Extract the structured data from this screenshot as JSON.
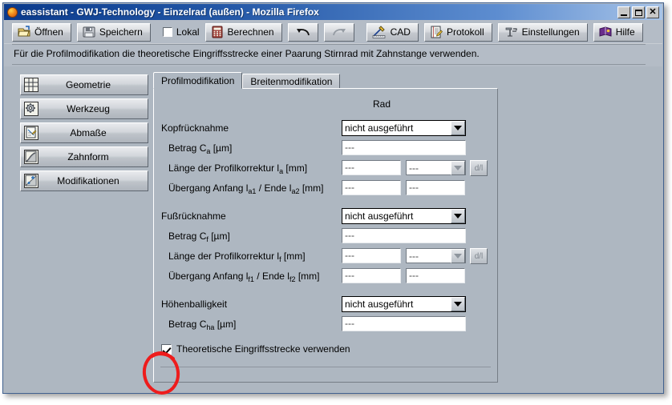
{
  "window": {
    "title": "eassistant - GWJ-Technology - Einzelrad (außen) - Mozilla Firefox",
    "app_icon": "firefox-icon",
    "minimize_label": "Minimieren",
    "maximize_label": "Maximieren",
    "close_label": "Schließen"
  },
  "toolbar": {
    "open_label": "Öffnen",
    "save_label": "Speichern",
    "lokal_label": "Lokal",
    "lokal_checked": false,
    "calc_label": "Berechnen",
    "undo_label": "",
    "redo_label": "",
    "cad_label": "CAD",
    "protocol_label": "Protokoll",
    "settings_label": "Einstellungen",
    "help_label": "Hilfe"
  },
  "hint": {
    "text": "Für die Profilmodifikation die theoretische Eingriffsstrecke einer Paarung Stirnrad mit Zahnstange verwenden."
  },
  "sidebar": {
    "items": [
      {
        "label": "Geometrie",
        "icon": "grid-icon"
      },
      {
        "label": "Werkzeug",
        "icon": "gear-icon"
      },
      {
        "label": "Abmaße",
        "icon": "ruler-icon"
      },
      {
        "label": "Zahnform",
        "icon": "curve-icon"
      },
      {
        "label": "Modifikationen",
        "icon": "modify-icon"
      }
    ]
  },
  "tabs": [
    {
      "label": "Profilmodifikation",
      "active": true
    },
    {
      "label": "Breitenmodifikation",
      "active": false
    }
  ],
  "panel": {
    "column_header": "Rad",
    "groups": [
      {
        "title": "Kopfrücknahme",
        "select_value": "nicht ausgeführt",
        "rows": [
          {
            "label_pre": "Betrag C",
            "label_sub": "a",
            "label_post": " [µm]",
            "value": "---"
          },
          {
            "label_pre": "Länge der Profilkorrektur l",
            "label_sub": "a",
            "label_post": " [mm]",
            "value": "---",
            "second_value": "---",
            "has_select": true,
            "has_dl_button": true,
            "dl_label": "d/l"
          },
          {
            "label_pre": "Übergang Anfang l",
            "label_sub": "a1",
            "label_mid": " / Ende l",
            "label_sub2": "a2",
            "label_post": " [mm]",
            "value": "---",
            "second_value": "---"
          }
        ]
      },
      {
        "title": "Fußrücknahme",
        "select_value": "nicht ausgeführt",
        "rows": [
          {
            "label_pre": "Betrag C",
            "label_sub": "f",
            "label_post": " [µm]",
            "value": "---"
          },
          {
            "label_pre": "Länge der Profilkorrektur l",
            "label_sub": "f",
            "label_post": " [mm]",
            "value": "---",
            "second_value": "---",
            "has_select": true,
            "has_dl_button": true,
            "dl_label": "d/l"
          },
          {
            "label_pre": "Übergang Anfang l",
            "label_sub": "f1",
            "label_mid": " / Ende l",
            "label_sub2": "f2",
            "label_post": " [mm]",
            "value": "---",
            "second_value": "---"
          }
        ]
      },
      {
        "title": "Höhenballigkeit",
        "select_value": "nicht ausgeführt",
        "rows": [
          {
            "label_pre": "Betrag C",
            "label_sub": "ha",
            "label_post": " [µm]",
            "value": "---"
          }
        ]
      }
    ],
    "bottom_checkbox": {
      "label": "Theoretische Eingriffsstrecke verwenden",
      "checked": true
    }
  },
  "annotation": {
    "shape": "red-ellipse",
    "color": "#ee1c1c",
    "target": "Theoretische Eingriffsstrecke verwenden checkbox"
  },
  "colors": {
    "window_background": "#aeb7c1",
    "titlebar_start": "#0a3a8c",
    "titlebar_end": "#a8c4e8",
    "field_background": "#ffffff",
    "annotation_red": "#ee1c1c"
  }
}
